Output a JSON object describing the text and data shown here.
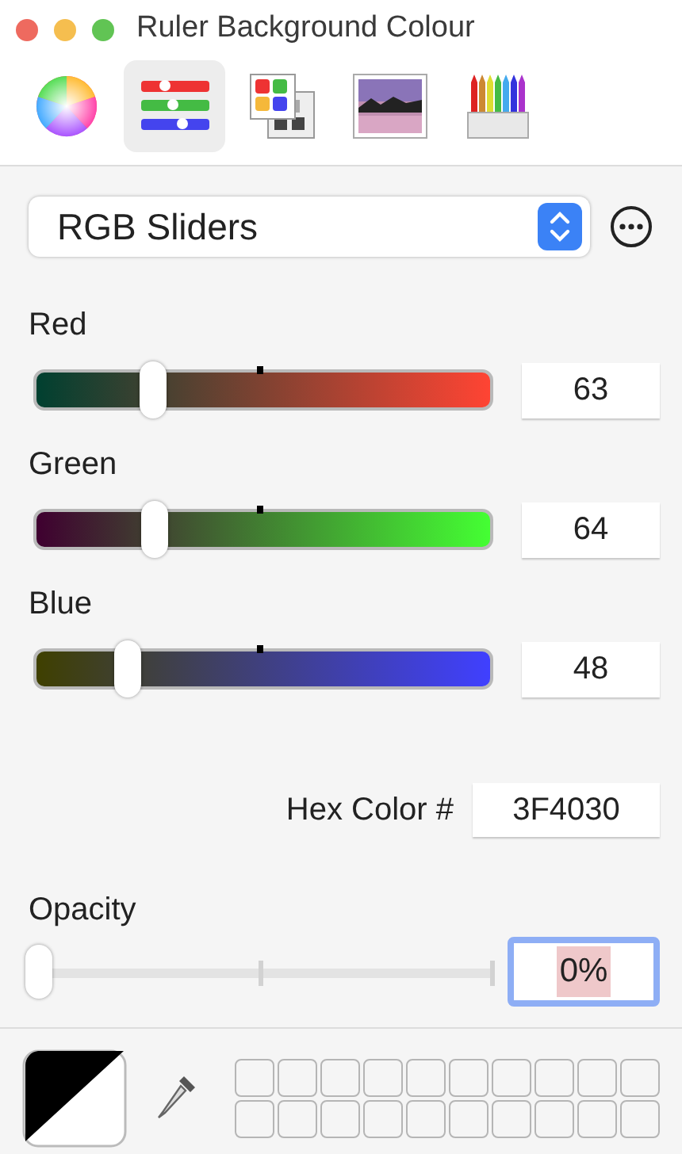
{
  "window": {
    "title": "Ruler Background Colour"
  },
  "modes": [
    {
      "kind": "wheel",
      "selected": false
    },
    {
      "kind": "sliders",
      "selected": true
    },
    {
      "kind": "palettes",
      "selected": false
    },
    {
      "kind": "image",
      "selected": false
    },
    {
      "kind": "pencils",
      "selected": false
    }
  ],
  "slider_type": {
    "value": "RGB Sliders"
  },
  "sliders": [
    {
      "label": "Red",
      "level": 0.247,
      "value": "63",
      "color": "#ff4433"
    },
    {
      "label": "Green",
      "level": 0.251,
      "value": "64",
      "color": "#44ff33"
    },
    {
      "label": "Blue",
      "level": 0.188,
      "value": "48",
      "color": "#4040ff"
    }
  ],
  "hex": {
    "label": "Hex Color #",
    "value": "3F4030"
  },
  "opacity": {
    "label": "Opacity",
    "level": 0,
    "value": "0%",
    "focused": true
  }
}
